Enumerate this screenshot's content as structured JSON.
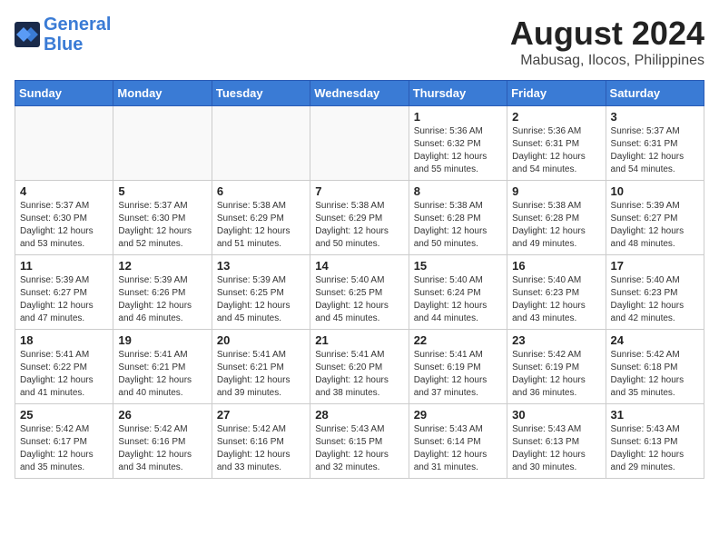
{
  "logo": {
    "line1": "General",
    "line2": "Blue"
  },
  "title": "August 2024",
  "location": "Mabusag, Ilocos, Philippines",
  "weekdays": [
    "Sunday",
    "Monday",
    "Tuesday",
    "Wednesday",
    "Thursday",
    "Friday",
    "Saturday"
  ],
  "weeks": [
    [
      {
        "day": "",
        "info": ""
      },
      {
        "day": "",
        "info": ""
      },
      {
        "day": "",
        "info": ""
      },
      {
        "day": "",
        "info": ""
      },
      {
        "day": "1",
        "info": "Sunrise: 5:36 AM\nSunset: 6:32 PM\nDaylight: 12 hours\nand 55 minutes."
      },
      {
        "day": "2",
        "info": "Sunrise: 5:36 AM\nSunset: 6:31 PM\nDaylight: 12 hours\nand 54 minutes."
      },
      {
        "day": "3",
        "info": "Sunrise: 5:37 AM\nSunset: 6:31 PM\nDaylight: 12 hours\nand 54 minutes."
      }
    ],
    [
      {
        "day": "4",
        "info": "Sunrise: 5:37 AM\nSunset: 6:30 PM\nDaylight: 12 hours\nand 53 minutes."
      },
      {
        "day": "5",
        "info": "Sunrise: 5:37 AM\nSunset: 6:30 PM\nDaylight: 12 hours\nand 52 minutes."
      },
      {
        "day": "6",
        "info": "Sunrise: 5:38 AM\nSunset: 6:29 PM\nDaylight: 12 hours\nand 51 minutes."
      },
      {
        "day": "7",
        "info": "Sunrise: 5:38 AM\nSunset: 6:29 PM\nDaylight: 12 hours\nand 50 minutes."
      },
      {
        "day": "8",
        "info": "Sunrise: 5:38 AM\nSunset: 6:28 PM\nDaylight: 12 hours\nand 50 minutes."
      },
      {
        "day": "9",
        "info": "Sunrise: 5:38 AM\nSunset: 6:28 PM\nDaylight: 12 hours\nand 49 minutes."
      },
      {
        "day": "10",
        "info": "Sunrise: 5:39 AM\nSunset: 6:27 PM\nDaylight: 12 hours\nand 48 minutes."
      }
    ],
    [
      {
        "day": "11",
        "info": "Sunrise: 5:39 AM\nSunset: 6:27 PM\nDaylight: 12 hours\nand 47 minutes."
      },
      {
        "day": "12",
        "info": "Sunrise: 5:39 AM\nSunset: 6:26 PM\nDaylight: 12 hours\nand 46 minutes."
      },
      {
        "day": "13",
        "info": "Sunrise: 5:39 AM\nSunset: 6:25 PM\nDaylight: 12 hours\nand 45 minutes."
      },
      {
        "day": "14",
        "info": "Sunrise: 5:40 AM\nSunset: 6:25 PM\nDaylight: 12 hours\nand 45 minutes."
      },
      {
        "day": "15",
        "info": "Sunrise: 5:40 AM\nSunset: 6:24 PM\nDaylight: 12 hours\nand 44 minutes."
      },
      {
        "day": "16",
        "info": "Sunrise: 5:40 AM\nSunset: 6:23 PM\nDaylight: 12 hours\nand 43 minutes."
      },
      {
        "day": "17",
        "info": "Sunrise: 5:40 AM\nSunset: 6:23 PM\nDaylight: 12 hours\nand 42 minutes."
      }
    ],
    [
      {
        "day": "18",
        "info": "Sunrise: 5:41 AM\nSunset: 6:22 PM\nDaylight: 12 hours\nand 41 minutes."
      },
      {
        "day": "19",
        "info": "Sunrise: 5:41 AM\nSunset: 6:21 PM\nDaylight: 12 hours\nand 40 minutes."
      },
      {
        "day": "20",
        "info": "Sunrise: 5:41 AM\nSunset: 6:21 PM\nDaylight: 12 hours\nand 39 minutes."
      },
      {
        "day": "21",
        "info": "Sunrise: 5:41 AM\nSunset: 6:20 PM\nDaylight: 12 hours\nand 38 minutes."
      },
      {
        "day": "22",
        "info": "Sunrise: 5:41 AM\nSunset: 6:19 PM\nDaylight: 12 hours\nand 37 minutes."
      },
      {
        "day": "23",
        "info": "Sunrise: 5:42 AM\nSunset: 6:19 PM\nDaylight: 12 hours\nand 36 minutes."
      },
      {
        "day": "24",
        "info": "Sunrise: 5:42 AM\nSunset: 6:18 PM\nDaylight: 12 hours\nand 35 minutes."
      }
    ],
    [
      {
        "day": "25",
        "info": "Sunrise: 5:42 AM\nSunset: 6:17 PM\nDaylight: 12 hours\nand 35 minutes."
      },
      {
        "day": "26",
        "info": "Sunrise: 5:42 AM\nSunset: 6:16 PM\nDaylight: 12 hours\nand 34 minutes."
      },
      {
        "day": "27",
        "info": "Sunrise: 5:42 AM\nSunset: 6:16 PM\nDaylight: 12 hours\nand 33 minutes."
      },
      {
        "day": "28",
        "info": "Sunrise: 5:43 AM\nSunset: 6:15 PM\nDaylight: 12 hours\nand 32 minutes."
      },
      {
        "day": "29",
        "info": "Sunrise: 5:43 AM\nSunset: 6:14 PM\nDaylight: 12 hours\nand 31 minutes."
      },
      {
        "day": "30",
        "info": "Sunrise: 5:43 AM\nSunset: 6:13 PM\nDaylight: 12 hours\nand 30 minutes."
      },
      {
        "day": "31",
        "info": "Sunrise: 5:43 AM\nSunset: 6:13 PM\nDaylight: 12 hours\nand 29 minutes."
      }
    ]
  ]
}
